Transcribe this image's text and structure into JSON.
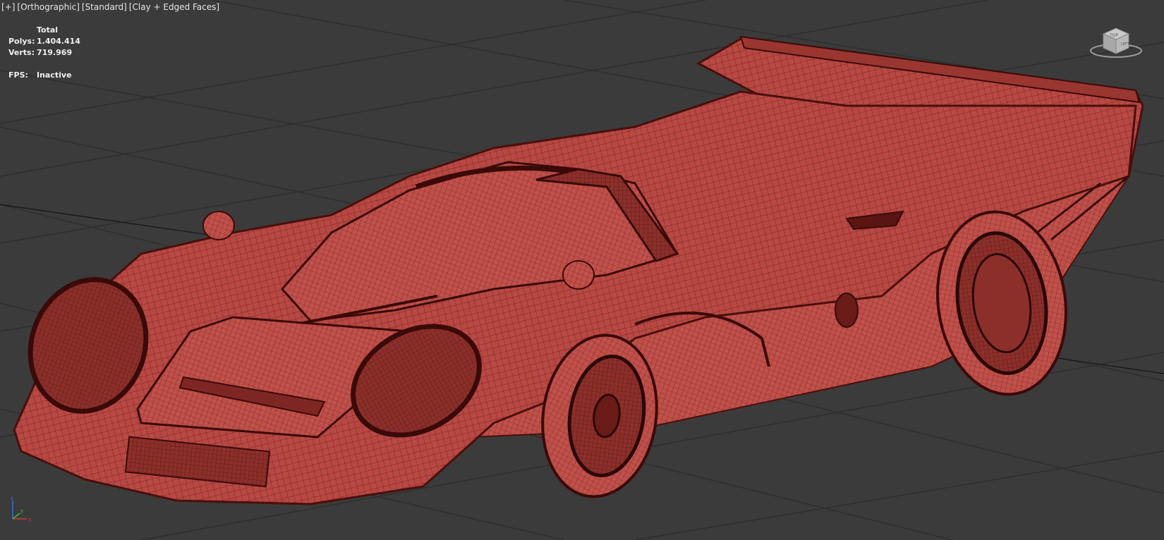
{
  "viewport": {
    "label_plus": "[+]",
    "label_view": "[Orthographic]",
    "label_shading": "[Standard]",
    "label_mode": "[Clay + Edged Faces]"
  },
  "stats": {
    "header": "Total",
    "polys_label": "Polys:",
    "polys_value": "1.404.414",
    "verts_label": "Verts:",
    "verts_value": "719.969",
    "fps_label": "FPS:",
    "fps_value": "Inactive"
  },
  "viewcube": {
    "top_label": "TOP",
    "side_label": "LEFT"
  },
  "axis": {
    "x": "x",
    "y": "y",
    "z": "z"
  },
  "colors": {
    "background": "#3b3b3b",
    "grid": "#2c2c2c",
    "clay": "#b94a43",
    "edge": "#5a1512"
  }
}
